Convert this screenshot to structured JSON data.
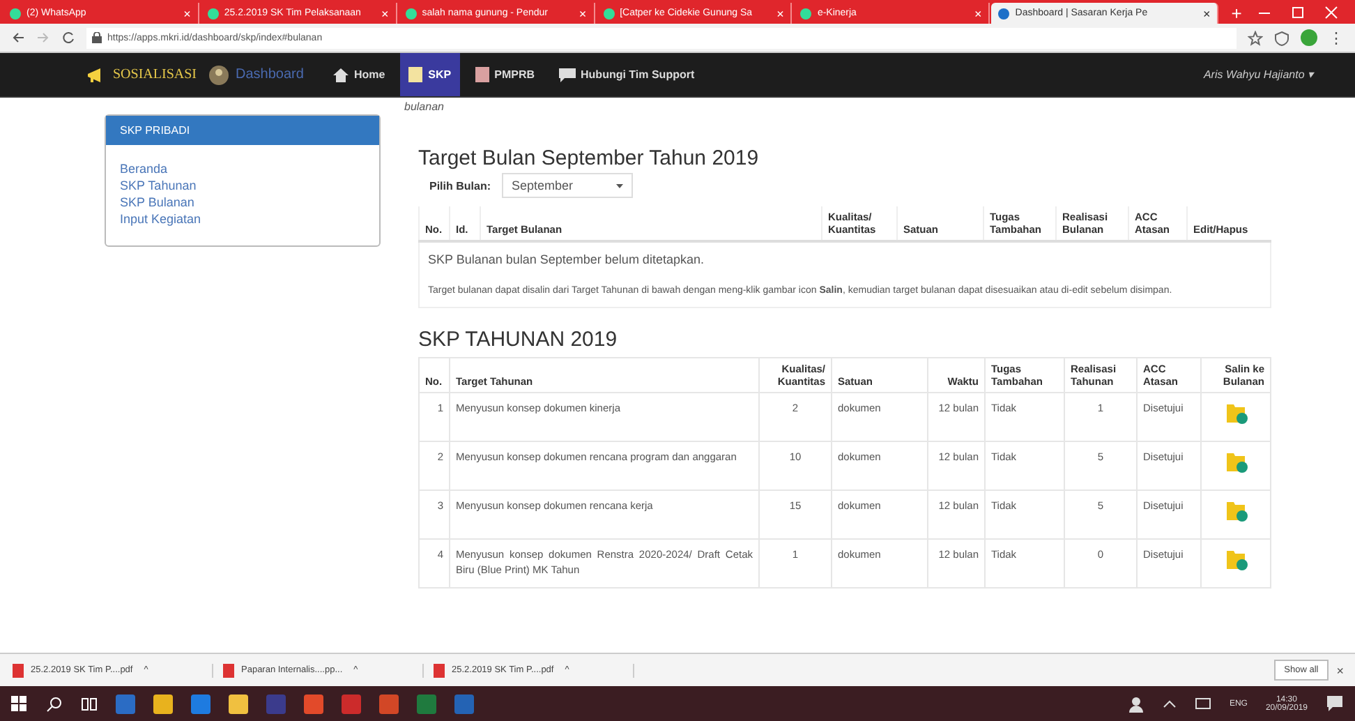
{
  "browser": {
    "tabs": [
      {
        "title": "(2) WhatsApp",
        "selected": false,
        "close": "×"
      },
      {
        "title": "25.2.2019 SK Tim Pelaksanaan",
        "selected": false,
        "close": "×"
      },
      {
        "title": "salah nama gunung - Pendur",
        "selected": false,
        "close": "×"
      },
      {
        "title": "[Catper ke Cidekie Gunung Sa",
        "selected": false,
        "close": "×"
      },
      {
        "title": "e-Kinerja",
        "selected": false,
        "close": "×"
      },
      {
        "title": "Dashboard | Sasaran Kerja Pe",
        "selected": true,
        "close": "×"
      }
    ],
    "new_tab": "+",
    "address": "https://apps.mkri.id/dashboard/skp/index#bulanan",
    "menu": "⋮"
  },
  "navbar": {
    "brand": "SOSIALISASI",
    "dashboard": "Dashboard",
    "items": [
      {
        "label": "Home",
        "kind": "home",
        "selected": false
      },
      {
        "label": "SKP",
        "kind": "doc",
        "selected": true
      },
      {
        "label": "PMPRB",
        "kind": "book",
        "selected": false
      },
      {
        "label": "Hubungi Tim Support",
        "kind": "chat",
        "selected": false
      }
    ],
    "user": "Aris Wahyu Hajianto ▾"
  },
  "sidebar": {
    "title": "SKP PRIBADI",
    "items": [
      "Beranda",
      "SKP Tahunan",
      "SKP Bulanan",
      "Input Kegiatan"
    ]
  },
  "breadcrumb": "bulanan",
  "monthly": {
    "title": "Target Bulan September Tahun 2019",
    "picker_label": "Pilih Bulan:",
    "picker_value": "September",
    "columns": [
      "No.",
      "Id.",
      "Target Bulanan",
      "Kualitas/ Kuantitas",
      "Satuan",
      "Tugas Tambahan",
      "Realisasi Bulanan",
      "ACC Atasan",
      "Edit/Hapus"
    ],
    "empty_message": "SKP Bulanan bulan September belum ditetapkan.",
    "hint": "Target bulanan dapat disalin dari Target Tahunan di bawah dengan meng-klik gambar icon **Salin**, kemudian target bulanan dapat disesuaikan atau di-edit sebelum disimpan."
  },
  "yearly": {
    "title": "SKP TAHUNAN 2019",
    "columns": [
      "No.",
      "Target Tahunan",
      "Kualitas/ Kuantitas",
      "Satuan",
      "Waktu",
      "Tugas Tambahan",
      "Realisasi Tahunan",
      "ACC Atasan",
      "Salin ke Bulanan"
    ],
    "rows": [
      {
        "no": "1",
        "target": "Menyusun konsep dokumen kinerja",
        "kualitas": "2",
        "satuan": "dokumen",
        "waktu": "12 bulan",
        "tugas": "Tidak",
        "realisasi": "1",
        "acc": "Disetujui"
      },
      {
        "no": "2",
        "target": "Menyusun konsep dokumen rencana program dan anggaran",
        "kualitas": "10",
        "satuan": "dokumen",
        "waktu": "12 bulan",
        "tugas": "Tidak",
        "realisasi": "5",
        "acc": "Disetujui"
      },
      {
        "no": "3",
        "target": "Menyusun konsep dokumen rencana kerja",
        "kualitas": "15",
        "satuan": "dokumen",
        "waktu": "12 bulan",
        "tugas": "Tidak",
        "realisasi": "5",
        "acc": "Disetujui"
      },
      {
        "no": "4",
        "target": "Menyusun konsep dokumen Renstra 2020-2024/ Draft Cetak Biru (Blue Print) MK Tahun",
        "kualitas": "1",
        "satuan": "dokumen",
        "waktu": "12 bulan",
        "tugas": "Tidak",
        "realisasi": "0",
        "acc": "Disetujui"
      }
    ]
  },
  "downloads": {
    "items": [
      {
        "name": "25.2.2019 SK Tim P....pdf",
        "caret": "^"
      },
      {
        "name": "Paparan Internalis....pp...",
        "caret": "^"
      },
      {
        "name": "25.2.2019 SK Tim P....pdf",
        "caret": "^"
      }
    ],
    "show_all": "Show all",
    "close": "×"
  },
  "taskbar": {
    "language": "ENG",
    "time": "14:30",
    "date": "20/09/2019"
  }
}
